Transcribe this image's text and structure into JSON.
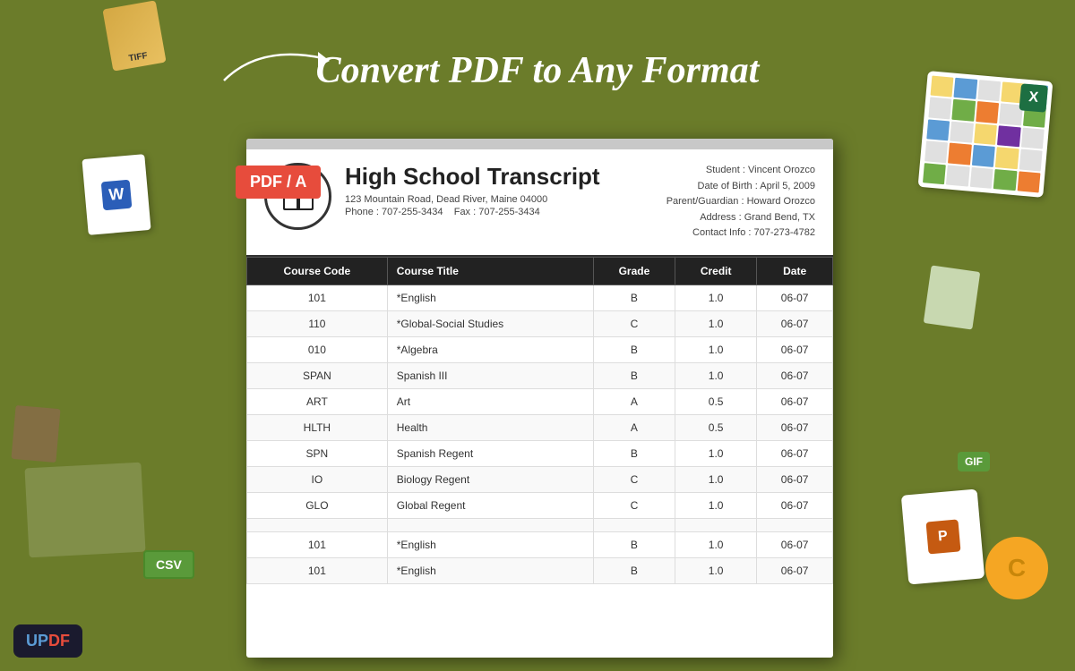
{
  "header": {
    "title": "Convert PDF to Any Format",
    "arrow": "→"
  },
  "pdf_badge": "PDF / A",
  "document": {
    "title": "High School Transcript",
    "address": "123 Mountain Road, Dead River, Maine 04000",
    "phone": "Phone : 707-255-3434",
    "fax": "Fax : 707-255-3434",
    "student": "Student : Vincent Orozco",
    "dob": "Date of Birth : April 5,  2009",
    "guardian": "Parent/Guardian : Howard Orozco",
    "addr2": "Address : Grand Bend, TX",
    "contact": "Contact Info : 707-273-4782",
    "table": {
      "headers": [
        "Course Code",
        "Course Title",
        "Grade",
        "Credit",
        "Date"
      ],
      "rows": [
        {
          "code": "101",
          "title": "*English",
          "grade": "B",
          "credit": "1.0",
          "date": "06-07"
        },
        {
          "code": "110",
          "title": "*Global-Social Studies",
          "grade": "C",
          "credit": "1.0",
          "date": "06-07"
        },
        {
          "code": "010",
          "title": "*Algebra",
          "grade": "B",
          "credit": "1.0",
          "date": "06-07"
        },
        {
          "code": "SPAN",
          "title": "Spanish III",
          "grade": "B",
          "credit": "1.0",
          "date": "06-07"
        },
        {
          "code": "ART",
          "title": "Art",
          "grade": "A",
          "credit": "0.5",
          "date": "06-07"
        },
        {
          "code": "HLTH",
          "title": "Health",
          "grade": "A",
          "credit": "0.5",
          "date": "06-07"
        },
        {
          "code": "SPN",
          "title": "Spanish Regent",
          "grade": "B",
          "credit": "1.0",
          "date": "06-07"
        },
        {
          "code": "IO",
          "title": "Biology Regent",
          "grade": "C",
          "credit": "1.0",
          "date": "06-07"
        },
        {
          "code": "GLO",
          "title": "Global Regent",
          "grade": "C",
          "credit": "1.0",
          "date": "06-07"
        },
        {
          "code": "",
          "title": "",
          "grade": "",
          "credit": "",
          "date": ""
        },
        {
          "code": "101",
          "title": "*English",
          "grade": "B",
          "credit": "1.0",
          "date": "06-07"
        },
        {
          "code": "101",
          "title": "*English",
          "grade": "B",
          "credit": "1.0",
          "date": "06-07"
        }
      ]
    }
  },
  "updf": {
    "label": "UPDF"
  },
  "badges": {
    "csv": "CSV",
    "gif": "GIF",
    "word": "W",
    "excel": "X",
    "ppt": "P",
    "c_lang": "C"
  }
}
